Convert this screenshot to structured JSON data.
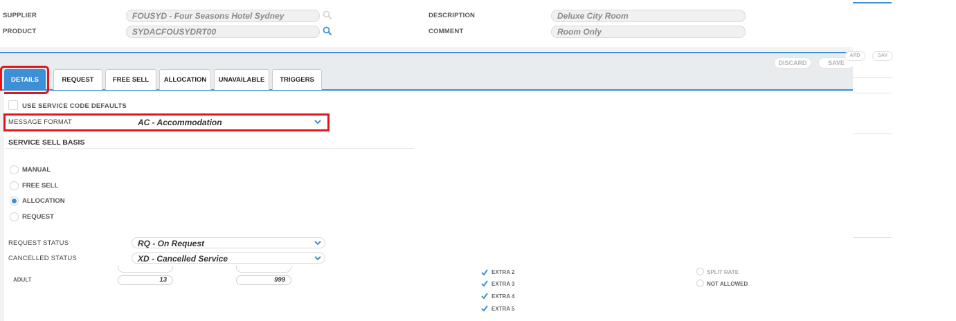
{
  "header": {
    "supplier_label": "SUPPLIER",
    "supplier_value": "FOUSYD - Four Seasons Hotel Sydney",
    "product_label": "PRODUCT",
    "product_value": "SYDACFOUSYDRT00",
    "description_label": "DESCRIPTION",
    "description_value": "Deluxe City Room",
    "comment_label": "COMMENT",
    "comment_value": "Room Only"
  },
  "toolbar": {
    "discard_label": "DISCARD",
    "save_label": "SAVE",
    "ghost_discard": "ARD",
    "ghost_save": "SAV"
  },
  "tabs": [
    {
      "label": "DETAILS",
      "active": true
    },
    {
      "label": "REQUEST"
    },
    {
      "label": "FREE SELL"
    },
    {
      "label": "ALLOCATION"
    },
    {
      "label": "UNAVAILABLE"
    },
    {
      "label": "TRIGGERS"
    }
  ],
  "details": {
    "use_defaults_label": "USE SERVICE CODE DEFAULTS",
    "message_format_label": "MESSAGE FORMAT",
    "message_format_value": "AC - Accommodation",
    "sell_basis_heading": "SERVICE SELL BASIS",
    "sell_basis_options": [
      {
        "label": "MANUAL",
        "selected": false
      },
      {
        "label": "FREE SELL",
        "selected": false
      },
      {
        "label": "ALLOCATION",
        "selected": true
      },
      {
        "label": "REQUEST",
        "selected": false
      }
    ],
    "request_status_label": "REQUEST STATUS",
    "request_status_value": "RQ - On Request",
    "cancelled_status_label": "CANCELLED STATUS",
    "cancelled_status_value": "XD - Cancelled Service"
  },
  "background": {
    "adult_label": "ADULT",
    "adult_min": "13",
    "adult_max": "999",
    "extras": [
      "EXTRA 2",
      "EXTRA 3",
      "EXTRA 4",
      "EXTRA 5"
    ],
    "rate_options": [
      "SPLIT RATE",
      "NOT ALLOWED"
    ]
  },
  "colors": {
    "accent": "#3d8fd6",
    "highlight": "#e0161d"
  }
}
